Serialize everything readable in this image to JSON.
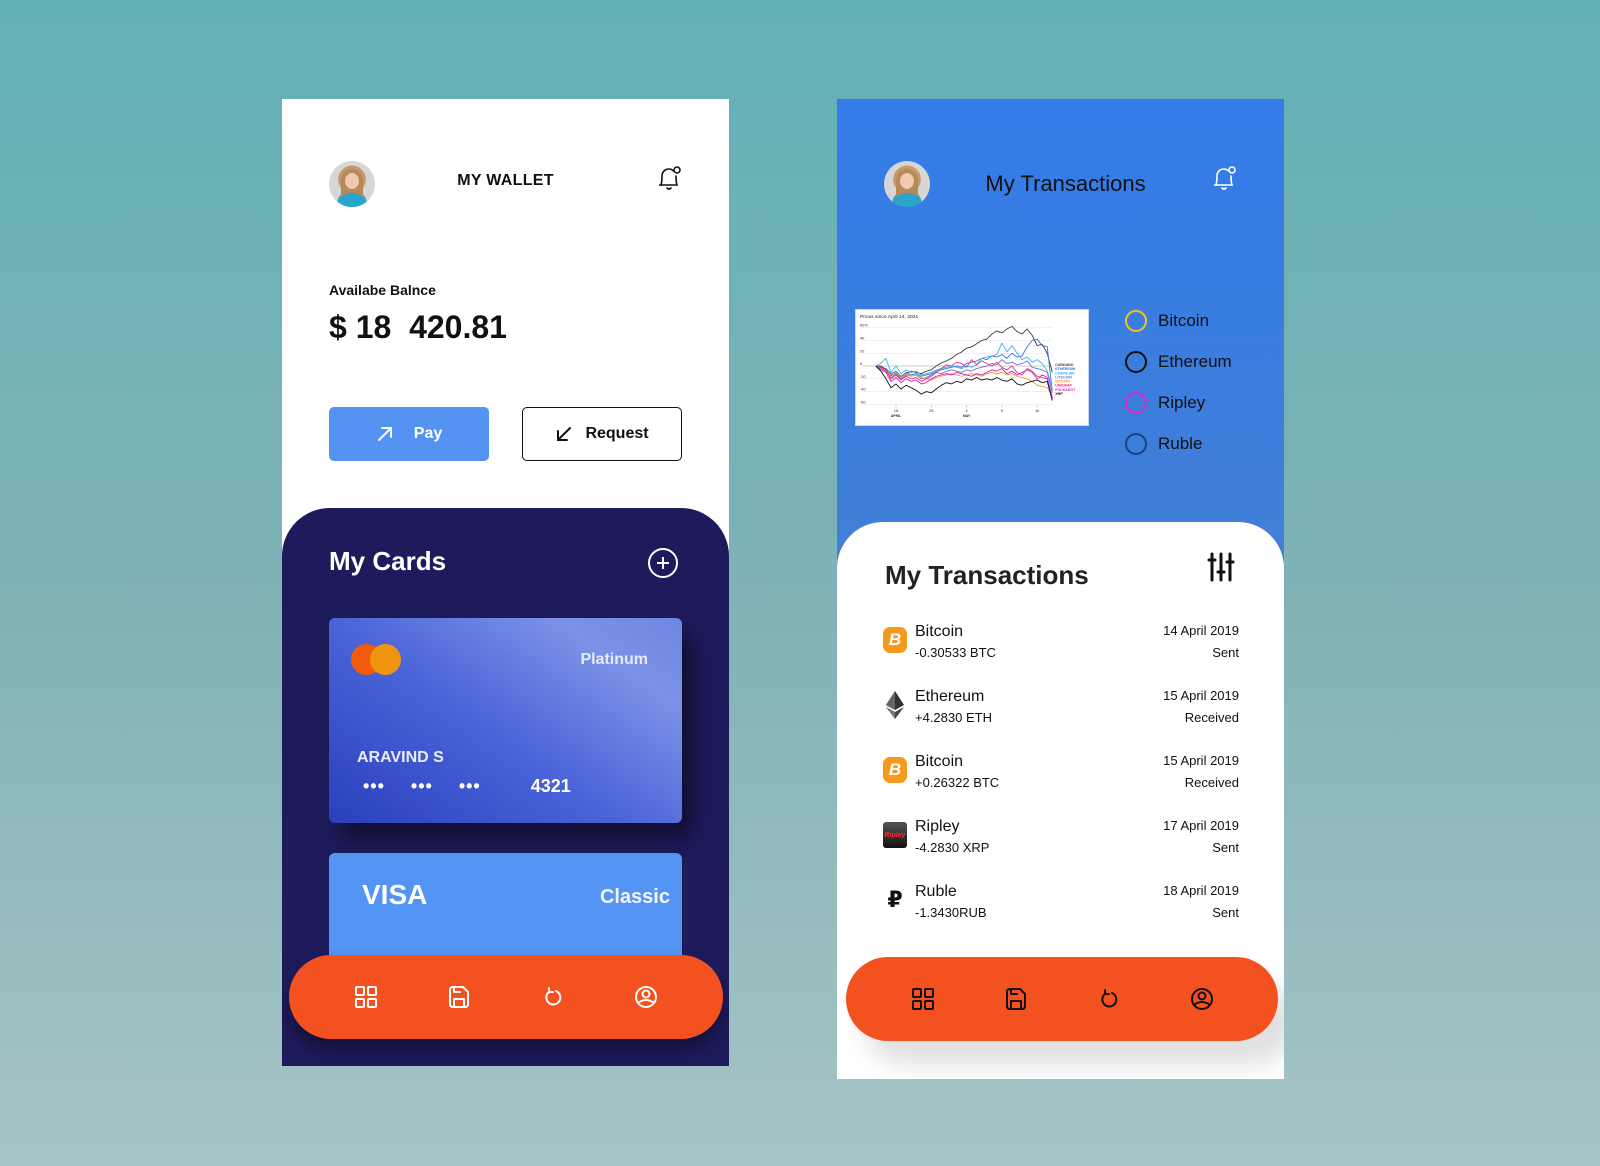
{
  "wallet": {
    "title": "MY WALLET",
    "balance_label": "Availabe Balnce",
    "balance_value": "$ 18  420.81",
    "pay_label": "Pay",
    "request_label": "Request",
    "cards_title": "My Cards",
    "cards": [
      {
        "brand": "mastercard",
        "tier": "Platinum",
        "holder": "ARAVIND S",
        "masked_groups": [
          "•••",
          "•••",
          "•••"
        ],
        "last4": "4321"
      },
      {
        "brand": "VISA",
        "tier": "Classic"
      }
    ],
    "nav": [
      "dashboard",
      "saved",
      "refresh",
      "profile"
    ]
  },
  "transactions_screen": {
    "title": "My Transactions",
    "legend": [
      {
        "label": "Bitcoin",
        "color": "#f2c21b"
      },
      {
        "label": "Ethereum",
        "color": "#111111"
      },
      {
        "label": "Ripley",
        "color": "#e027c7"
      },
      {
        "label": "Ruble",
        "color": "#1e3f7a"
      }
    ],
    "panel_title": "My Transactions",
    "items": [
      {
        "icon": "bitcoin",
        "name": "Bitcoin",
        "amount": "-0.30533 BTC",
        "date": "14 April 2019",
        "status": "Sent"
      },
      {
        "icon": "ethereum",
        "name": "Ethereum",
        "amount": "+4.2830 ETH",
        "date": "15 April 2019",
        "status": "Received"
      },
      {
        "icon": "bitcoin",
        "name": "Bitcoin",
        "amount": "+0.26322 BTC",
        "date": "15 April 2019",
        "status": "Received"
      },
      {
        "icon": "ripley",
        "name": "Ripley",
        "amount": "-4.2830 XRP",
        "date": "17 April 2019",
        "status": "Sent"
      },
      {
        "icon": "ruble",
        "name": "Ruble",
        "amount": "-1.3430RUB",
        "date": "18 April 2019",
        "status": "Sent"
      }
    ]
  },
  "chart_data": {
    "type": "line",
    "title": "Prices since April 14, 2021",
    "xlabel": "",
    "ylabel": "",
    "yticks": [
      "60%",
      "40",
      "20",
      "0",
      "-20",
      "-40",
      "-60"
    ],
    "ylim": [
      -60,
      60
    ],
    "xticks": [
      {
        "label": "18",
        "sub": "APRIL",
        "i": 4
      },
      {
        "label": "25",
        "sub": "",
        "i": 11
      },
      {
        "label": "2",
        "sub": "MAY",
        "i": 18
      },
      {
        "label": "9",
        "sub": "",
        "i": 25
      },
      {
        "label": "16",
        "sub": "",
        "i": 32
      }
    ],
    "x": [
      0,
      1,
      2,
      3,
      4,
      5,
      6,
      7,
      8,
      9,
      10,
      11,
      12,
      13,
      14,
      15,
      16,
      17,
      18,
      19,
      20,
      21,
      22,
      23,
      24,
      25,
      26,
      27,
      28,
      29,
      30,
      31,
      32,
      33,
      34,
      35
    ],
    "series": [
      {
        "name": "CARDANO",
        "color": "#3a3a3a",
        "values": [
          0,
          0,
          -5,
          -15,
          -10,
          -18,
          -12,
          -8,
          -10,
          -12,
          -8,
          -6,
          0,
          5,
          8,
          12,
          18,
          22,
          28,
          30,
          35,
          40,
          42,
          50,
          55,
          52,
          58,
          62,
          54,
          50,
          58,
          48,
          32,
          34,
          20,
          -10
        ]
      },
      {
        "name": "ETHEREUM",
        "color": "#3b6fd8",
        "values": [
          0,
          -2,
          -4,
          -12,
          -8,
          -16,
          -10,
          -14,
          -12,
          -16,
          -14,
          -12,
          -8,
          -6,
          -4,
          -2,
          0,
          -2,
          4,
          6,
          8,
          12,
          10,
          16,
          14,
          18,
          12,
          20,
          14,
          16,
          30,
          40,
          42,
          32,
          30,
          -40
        ]
      },
      {
        "name": "CHAINLINK",
        "color": "#35b6f0",
        "values": [
          0,
          4,
          12,
          -10,
          0,
          -12,
          -6,
          -10,
          -8,
          -14,
          -12,
          -10,
          -6,
          -4,
          -2,
          0,
          -2,
          -4,
          0,
          -2,
          2,
          12,
          14,
          16,
          18,
          36,
          22,
          32,
          20,
          10,
          14,
          6,
          10,
          4,
          -8,
          -35
        ]
      },
      {
        "name": "LITECOIN",
        "color": "#6d74e0",
        "values": [
          0,
          -4,
          -8,
          -18,
          -12,
          -20,
          -14,
          -16,
          -14,
          -20,
          -18,
          -14,
          -10,
          -12,
          -8,
          -6,
          -8,
          -10,
          -6,
          -8,
          -4,
          -2,
          0,
          4,
          2,
          10,
          4,
          6,
          2,
          4,
          8,
          -2,
          -4,
          -6,
          -10,
          -42
        ]
      },
      {
        "name": "BITCOIN",
        "color": "#f39a2b",
        "values": [
          0,
          -3,
          -6,
          -14,
          -10,
          -18,
          -12,
          -16,
          -14,
          -18,
          -20,
          -22,
          -18,
          -16,
          -14,
          -12,
          -14,
          -16,
          -14,
          -12,
          -14,
          -16,
          -12,
          -10,
          -12,
          -10,
          -14,
          -12,
          -16,
          -18,
          -20,
          -24,
          -30,
          -32,
          -34,
          -45
        ]
      },
      {
        "name": "UNISWAP",
        "color": "#ec2d7a",
        "values": [
          0,
          -2,
          -6,
          -20,
          -14,
          -22,
          -16,
          -20,
          -18,
          -24,
          -20,
          -16,
          -10,
          -4,
          2,
          0,
          6,
          4,
          -2,
          10,
          2,
          8,
          4,
          0,
          6,
          -2,
          -6,
          0,
          -10,
          -14,
          -4,
          -8,
          -16,
          -18,
          -20,
          -50
        ]
      },
      {
        "name": "POLKADOT",
        "color": "#d81bb7",
        "values": [
          0,
          -6,
          -10,
          -24,
          -18,
          -26,
          -20,
          -24,
          -22,
          -28,
          -26,
          -20,
          -16,
          -14,
          -12,
          -14,
          -10,
          -12,
          -14,
          -16,
          -12,
          -14,
          -10,
          -6,
          -8,
          -4,
          -12,
          -8,
          -14,
          -10,
          -6,
          -10,
          -20,
          -14,
          -18,
          -52
        ]
      },
      {
        "name": "XRP",
        "color": "#111111",
        "values": [
          0,
          -8,
          -20,
          -34,
          -28,
          -36,
          -30,
          -34,
          -38,
          -44,
          -40,
          -42,
          -36,
          -30,
          -26,
          -28,
          -24,
          -26,
          -20,
          -22,
          -18,
          -22,
          -20,
          -22,
          -18,
          -22,
          -24,
          -20,
          -28,
          -30,
          -26,
          -24,
          -22,
          -26,
          -24,
          -54
        ]
      }
    ],
    "legend_position": "right",
    "grid": true
  }
}
